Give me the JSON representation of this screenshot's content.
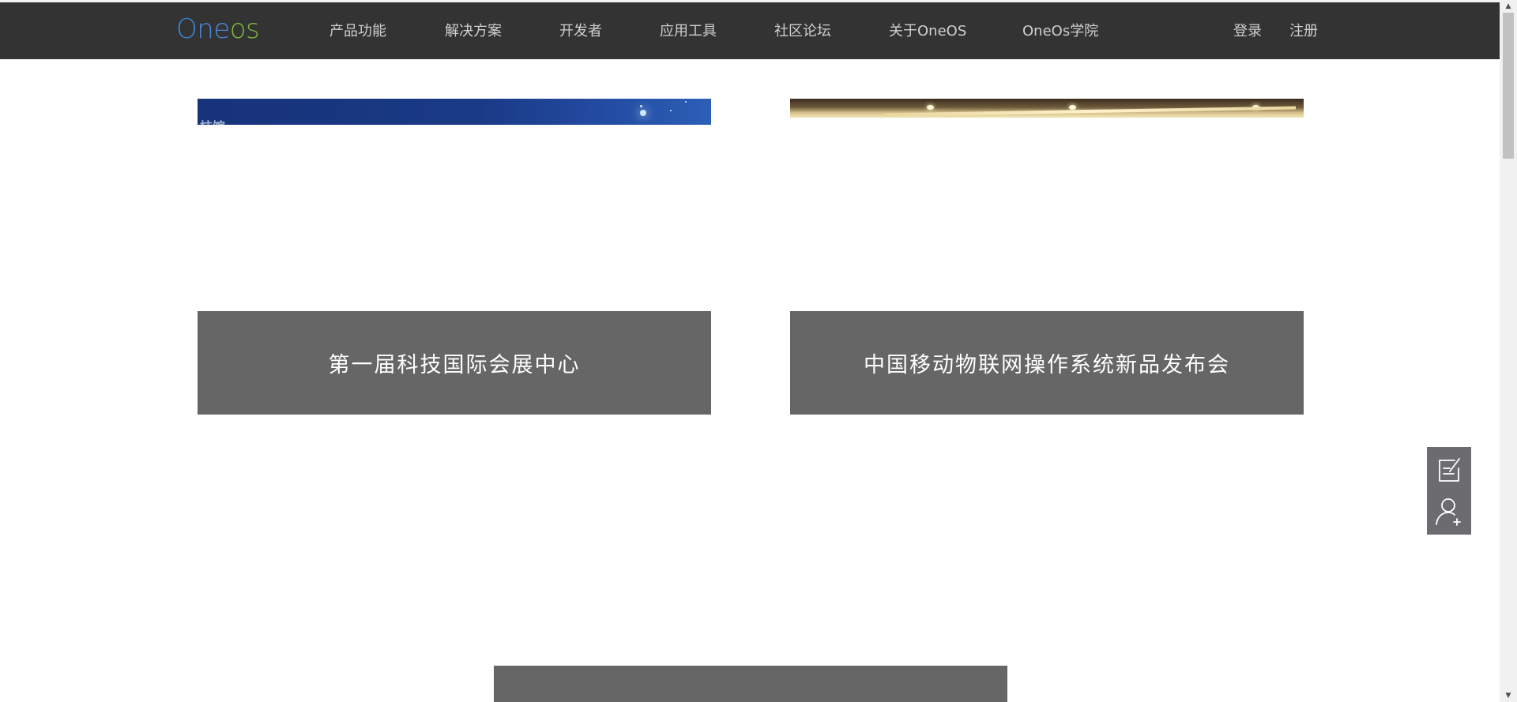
{
  "header": {
    "logo_text": "Oneos",
    "nav": [
      {
        "label": "产品功能"
      },
      {
        "label": "解决方案"
      },
      {
        "label": "开发者"
      },
      {
        "label": "应用工具"
      },
      {
        "label": "社区论坛"
      },
      {
        "label": "关于OneOS"
      },
      {
        "label": "OneOs学院"
      }
    ],
    "login_label": "登录",
    "register_label": "注册"
  },
  "cards": [
    {
      "image_text": "技馆",
      "caption": "第一届科技国际会展中心"
    },
    {
      "caption": "中国移动物联网操作系统新品发布会"
    },
    {
      "caption": ""
    }
  ],
  "side_tools": [
    {
      "icon": "edit-icon"
    },
    {
      "icon": "add-user-icon"
    }
  ],
  "colors": {
    "navbar_bg": "#333333",
    "caption_bg": "#666666",
    "logo_blue": "#3f86d3",
    "logo_green": "#7fb83a",
    "side_tools_bg": "#6c6c70"
  }
}
